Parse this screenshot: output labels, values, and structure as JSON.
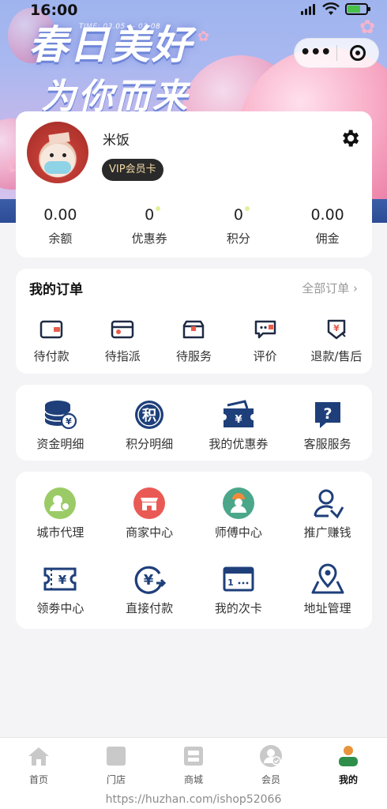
{
  "status_bar": {
    "time": "16:00"
  },
  "banner": {
    "title_line1": "春日美好",
    "title_line2": "为你而来",
    "date_text": "TIME: 03.05 — 03.08"
  },
  "profile": {
    "nickname": "米饭",
    "vip_label": "VIP会员卡",
    "stats": [
      {
        "value": "0.00",
        "label": "余额"
      },
      {
        "value": "0",
        "label": "优惠券"
      },
      {
        "value": "0",
        "label": "积分"
      },
      {
        "value": "0.00",
        "label": "佣金"
      }
    ]
  },
  "orders": {
    "title": "我的订单",
    "all_label": "全部订单",
    "items": [
      {
        "label": "待付款",
        "icon": "wallet-icon"
      },
      {
        "label": "待指派",
        "icon": "card-icon"
      },
      {
        "label": "待服务",
        "icon": "box-icon"
      },
      {
        "label": "评价",
        "icon": "comment-icon"
      },
      {
        "label": "退款/售后",
        "icon": "refund-icon"
      }
    ]
  },
  "services": {
    "items": [
      {
        "label": "资金明细",
        "icon": "coins-icon"
      },
      {
        "label": "积分明细",
        "icon": "points-icon"
      },
      {
        "label": "我的优惠券",
        "icon": "coupon-icon"
      },
      {
        "label": "客服服务",
        "icon": "help-icon"
      }
    ]
  },
  "tools": {
    "items": [
      {
        "label": "城市代理",
        "icon": "city-agent-icon"
      },
      {
        "label": "商家中心",
        "icon": "merchant-icon"
      },
      {
        "label": "师傅中心",
        "icon": "worker-icon"
      },
      {
        "label": "推广赚钱",
        "icon": "promote-icon"
      },
      {
        "label": "领劵中心",
        "icon": "ticket-icon"
      },
      {
        "label": "直接付款",
        "icon": "pay-icon"
      },
      {
        "label": "我的次卡",
        "icon": "times-card-icon"
      },
      {
        "label": "地址管理",
        "icon": "address-icon"
      }
    ]
  },
  "tabbar": {
    "items": [
      {
        "label": "首页",
        "icon": "home-icon"
      },
      {
        "label": "门店",
        "icon": "store-icon"
      },
      {
        "label": "商城",
        "icon": "mall-icon"
      },
      {
        "label": "会员",
        "icon": "member-icon"
      },
      {
        "label": "我的",
        "icon": "profile-icon",
        "active": true
      }
    ]
  },
  "watermark": "https://huzhan.com/ishop52066",
  "colors": {
    "primary": "#1e3f7a",
    "accent": "#e95b4b",
    "vip_gold": "#f3d9a5",
    "active_tab": "#e8943a"
  }
}
